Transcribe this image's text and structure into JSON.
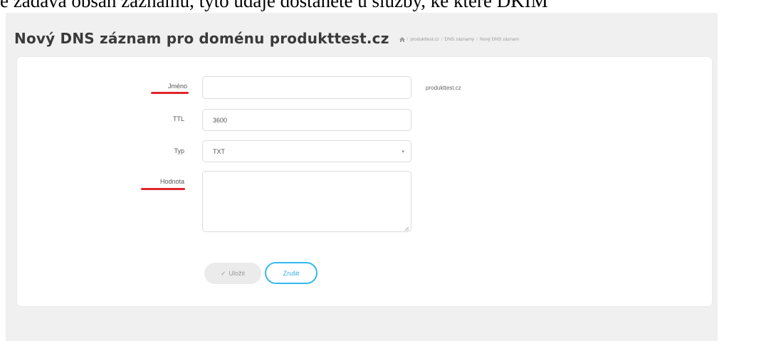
{
  "caption": "e zadává obsah záznamu, tyto údaje dostanete u služby, ke které DKIM",
  "header": {
    "title": "Nový DNS záznam pro doménu produkttest.cz",
    "breadcrumb": [
      "produkttest.cz",
      "DNS záznamy",
      "Nový DNS záznam"
    ]
  },
  "form": {
    "name_label": "Jméno",
    "name_value": "",
    "domain_suffix": "produkttest.cz",
    "ttl_label": "TTL",
    "ttl_value": "3600",
    "type_label": "Typ",
    "type_value": "TXT",
    "content_label": "Hodnota",
    "content_value": ""
  },
  "actions": {
    "save_label": "Uložit",
    "save_icon": "check-icon",
    "cancel_label": "Zrušit"
  },
  "colors": {
    "underline": "#e0262b",
    "cancel_border": "#34b8ee",
    "panel_background": "#f0f0f0"
  }
}
